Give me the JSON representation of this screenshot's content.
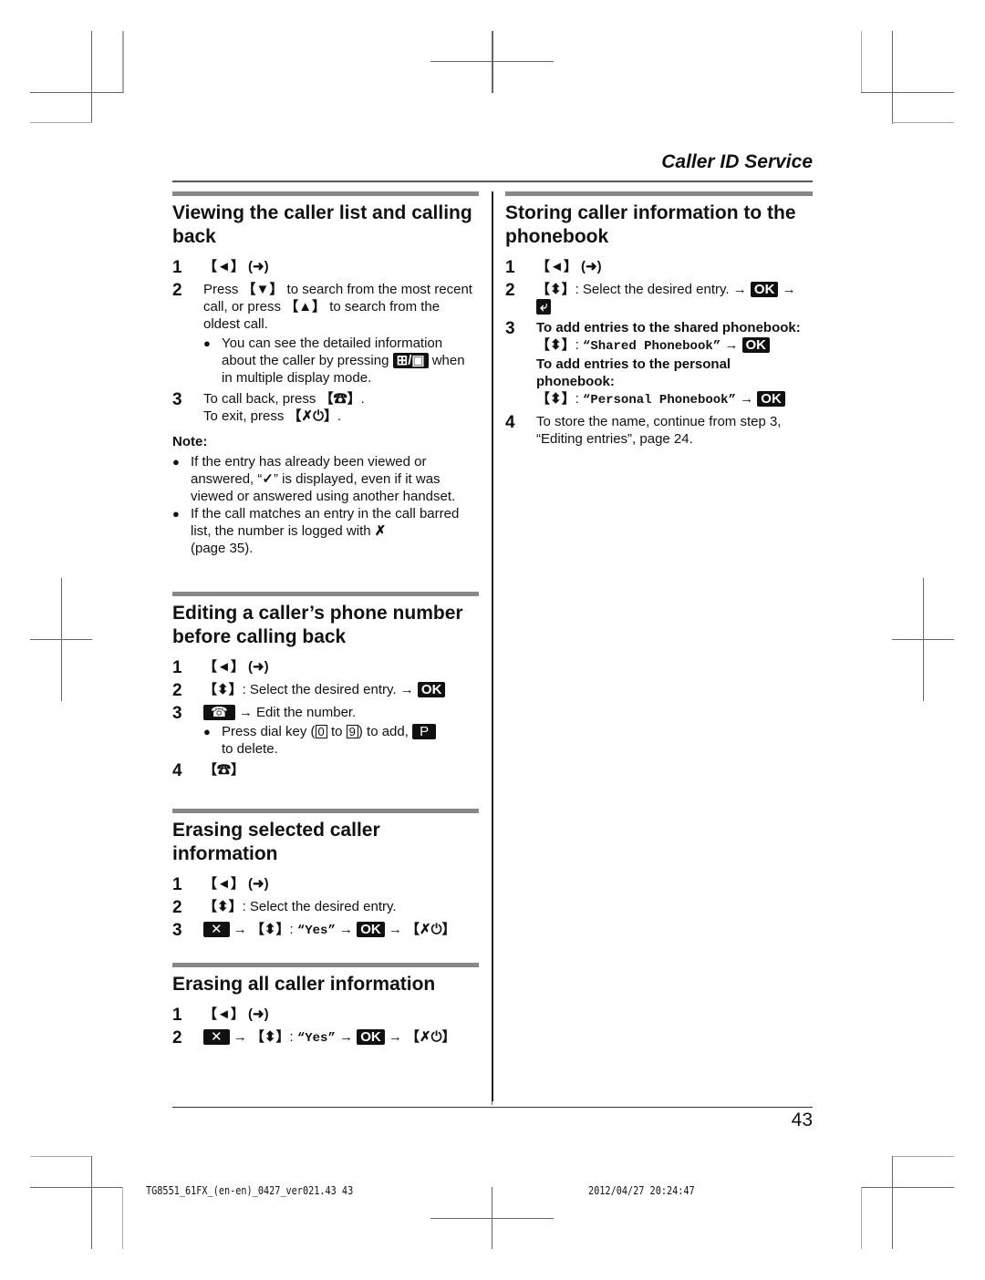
{
  "header": {
    "chapter_title": "Caller ID Service"
  },
  "glyphs": {
    "left_key": "【◄】",
    "incoming_icon": "(➜)",
    "down_key": "【▼】",
    "up_key": "【▲】",
    "updown_key": "【⬍】",
    "talk_key": "【☎】",
    "off_key": "【✗⏻】",
    "ok_soft": "OK",
    "delete_soft": "✕",
    "pause_soft": "P",
    "talk_soft": "☎",
    "phonebook_soft": "⤶",
    "display_mode_soft": "⊞/▣",
    "check_mark": "✓",
    "barred_icon": "✗",
    "arrow": "→",
    "digit_0": "0",
    "digit_9": "9"
  },
  "sections": {
    "viewing": {
      "title": "Viewing the caller list and calling back",
      "steps": [
        {
          "num": "1"
        },
        {
          "num": "2",
          "text_a": "Press ",
          "text_b": " to search from the most recent call, or press ",
          "text_c": " to search from the oldest call.",
          "bullet_a": "You can see the detailed information about the caller by pressing ",
          "bullet_b": " when in multiple display mode."
        },
        {
          "num": "3",
          "line1_a": "To call back, press ",
          "line1_b": ".",
          "line2_a": "To exit, press ",
          "line2_b": "."
        }
      ],
      "note_title": "Note:",
      "notes": [
        {
          "text_a": "If the entry has already been viewed or answered, “",
          "text_b": "” is displayed, even if it was viewed or answered using another handset."
        },
        {
          "text_a": "If the call matches an entry in the call barred list, the number is logged with ",
          "text_b": " (page 35)."
        }
      ]
    },
    "editing": {
      "title": "Editing a caller’s phone number before calling back",
      "steps": [
        {
          "num": "1"
        },
        {
          "num": "2",
          "text": ": Select the desired entry. "
        },
        {
          "num": "3",
          "text": " Edit the number.",
          "bullet_a": "Press dial key (",
          "bullet_b": " to ",
          "bullet_c": ") to add, ",
          "bullet_d": " to delete."
        },
        {
          "num": "4"
        }
      ]
    },
    "erasing_selected": {
      "title": "Erasing selected caller information",
      "steps": [
        {
          "num": "1"
        },
        {
          "num": "2",
          "text": ": Select the desired entry."
        },
        {
          "num": "3",
          "option": "“Yes”"
        }
      ]
    },
    "erasing_all": {
      "title": "Erasing all caller information",
      "steps": [
        {
          "num": "1"
        },
        {
          "num": "2",
          "option": "“Yes”"
        }
      ]
    },
    "storing": {
      "title": "Storing caller information to the phonebook",
      "steps": [
        {
          "num": "1"
        },
        {
          "num": "2",
          "text": ": Select the desired entry. "
        },
        {
          "num": "3",
          "shared_label": "To add entries to the shared phonebook:",
          "shared_option": "“Shared Phonebook”",
          "personal_label": "To add entries to the personal phonebook:",
          "personal_option": "“Personal Phonebook”"
        },
        {
          "num": "4",
          "text": "To store the name, continue from step 3, “Editing entries”, page 24."
        }
      ]
    }
  },
  "footer": {
    "page_number": "43",
    "print_file": "TG8551_61FX_(en-en)_0427_ver021.43    43",
    "print_date": "2012/04/27    20:24:47"
  }
}
